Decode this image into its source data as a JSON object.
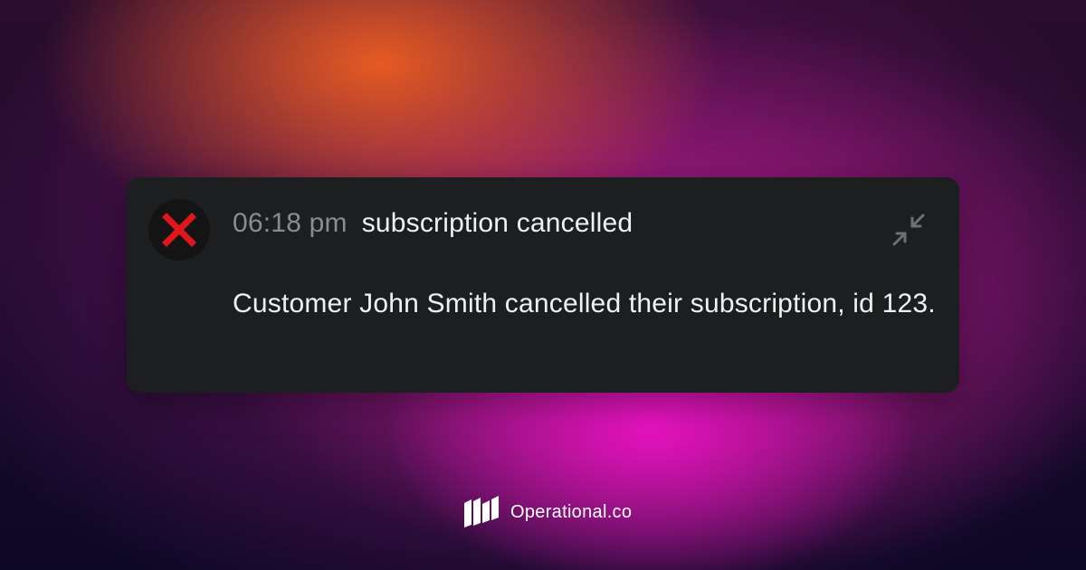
{
  "notification": {
    "status_icon": "x-mark-icon",
    "time": "06:18 pm",
    "title": "subscription cancelled",
    "message": "Customer John Smith cancelled their subscription, id 123.",
    "collapse_icon": "collapse-arrows-icon"
  },
  "brand": {
    "logo_icon": "operational-logo-icon",
    "name": "Operational.co"
  },
  "colors": {
    "card_background": "#1d1e20",
    "error_red": "#e0161d",
    "muted_text": "#8b8c8e",
    "primary_text": "#f1f1f1"
  }
}
